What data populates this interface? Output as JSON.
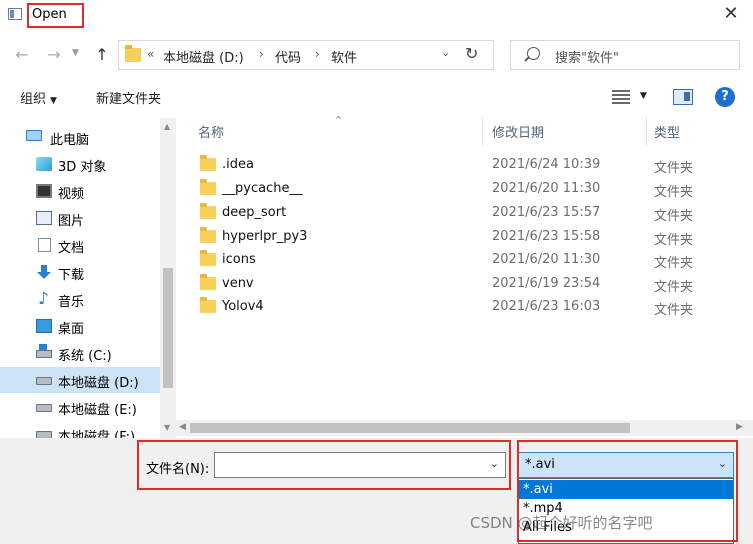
{
  "window": {
    "title": "Open",
    "close_glyph": "✕"
  },
  "nav": {
    "back_glyph": "←",
    "forward_glyph": "→",
    "up_glyph": "↑",
    "breadcrumb": [
      "本地磁盘 (D:)",
      "代码",
      "软件"
    ],
    "breadcrumb_prefix": "«",
    "separator": "›",
    "refresh_glyph": "↻",
    "search_placeholder": "搜索\"软件\""
  },
  "toolbar": {
    "organize": "组织",
    "new_folder": "新建文件夹",
    "help": "?"
  },
  "sidebar": {
    "items": [
      {
        "label": "此电脑",
        "icon": "computer-icon"
      },
      {
        "label": "3D 对象",
        "icon": "3d-objects-icon"
      },
      {
        "label": "视频",
        "icon": "video-icon"
      },
      {
        "label": "图片",
        "icon": "pictures-icon"
      },
      {
        "label": "文档",
        "icon": "documents-icon"
      },
      {
        "label": "下载",
        "icon": "download-icon"
      },
      {
        "label": "音乐",
        "icon": "music-icon"
      },
      {
        "label": "桌面",
        "icon": "desktop-icon"
      },
      {
        "label": "系统 (C:)",
        "icon": "system-drive-icon"
      },
      {
        "label": "本地磁盘 (D:)",
        "icon": "drive-icon",
        "selected": true
      },
      {
        "label": "本地磁盘 (E:)",
        "icon": "drive-icon"
      },
      {
        "label": "本地磁盘 (F:)",
        "icon": "drive-icon"
      }
    ]
  },
  "filelist": {
    "columns": {
      "name": "名称",
      "date": "修改日期",
      "type": "类型"
    },
    "rows": [
      {
        "name": ".idea",
        "date": "2021/6/24 10:39",
        "type": "文件夹"
      },
      {
        "name": "__pycache__",
        "date": "2021/6/20 11:30",
        "type": "文件夹"
      },
      {
        "name": "deep_sort",
        "date": "2021/6/23 15:57",
        "type": "文件夹"
      },
      {
        "name": "hyperlpr_py3",
        "date": "2021/6/23 15:58",
        "type": "文件夹"
      },
      {
        "name": "icons",
        "date": "2021/6/20 11:30",
        "type": "文件夹"
      },
      {
        "name": "venv",
        "date": "2021/6/19 23:54",
        "type": "文件夹"
      },
      {
        "name": "Yolov4",
        "date": "2021/6/23 16:03",
        "type": "文件夹"
      }
    ]
  },
  "bottom": {
    "filename_label": "文件名(N):",
    "filename_value": "",
    "filetype_selected": "*.avi",
    "filetype_options": [
      "*.avi",
      "*.mp4",
      "All Files"
    ]
  },
  "watermark": "CSDN @起个好听的名字吧",
  "colors": {
    "highlight_red": "#e02b2b",
    "select_blue": "#0078d7",
    "sidebar_selected": "#cce4f7"
  }
}
